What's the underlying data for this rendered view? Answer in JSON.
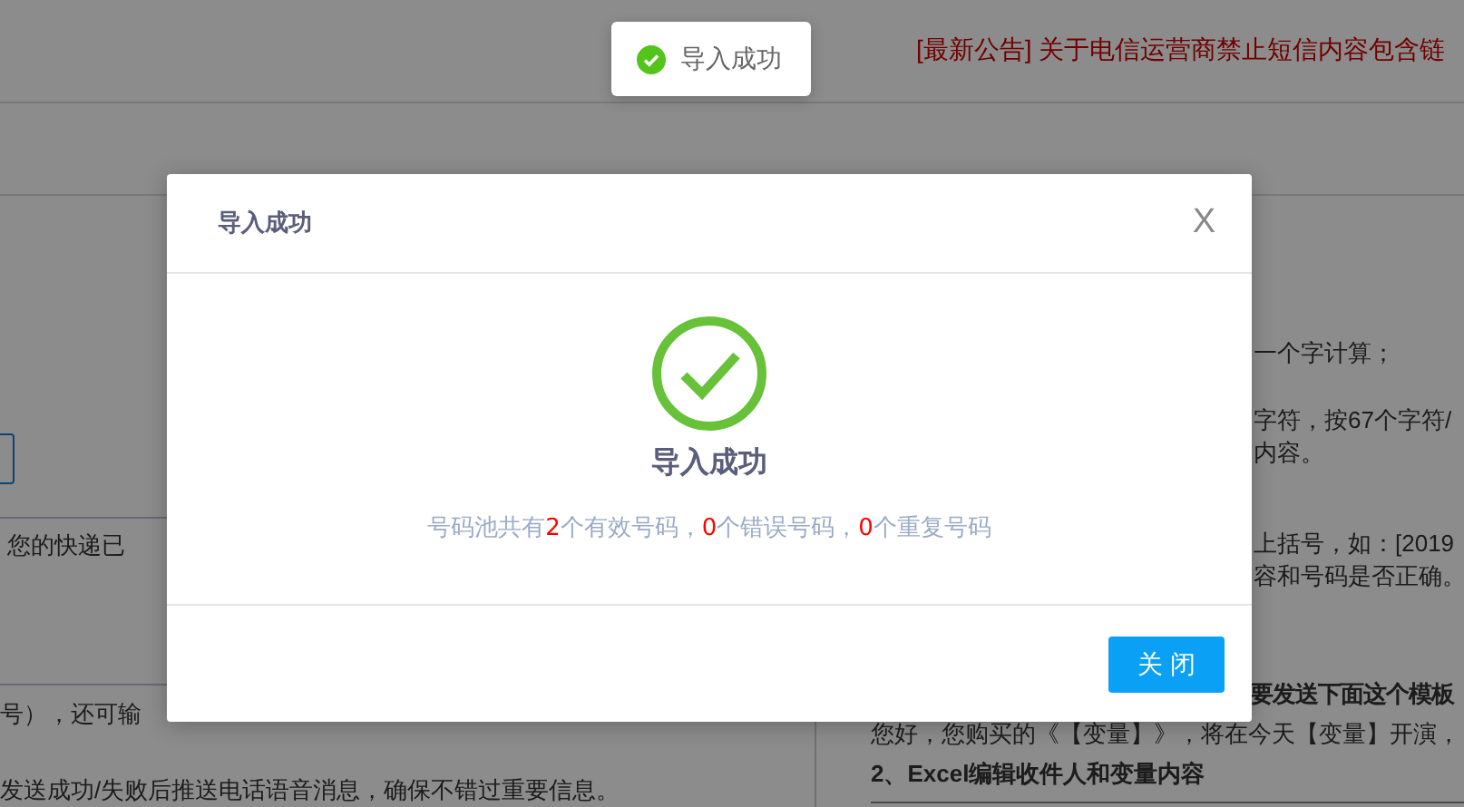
{
  "notice": "[最新公告] 关于电信运营商禁止短信内容包含链",
  "background": {
    "left_lines": [
      {
        "kind": "field",
        "text": "您的快递已"
      },
      {
        "kind": "text",
        "text": "号），还可输"
      },
      {
        "kind": "text",
        "text": "发送成功/失败后推送电话语音消息，确保不错过重要信息。"
      }
    ],
    "right_lines": [
      {
        "kind": "hidden",
        "text": "一个字计算；"
      },
      {
        "kind": "hidden",
        "text": "字符，按67个字符/"
      },
      {
        "kind": "hidden",
        "text": "内容。"
      },
      {
        "kind": "hidden",
        "text": "上括号，如：[2019"
      },
      {
        "kind": "hidden",
        "text": "容和号码是否正确。"
      },
      {
        "kind": "hidden_heading",
        "text": "要发送下面这个模板"
      },
      {
        "kind": "text",
        "text": "您好，您购买的《【变量】》，将在今天【变量】开演，"
      },
      {
        "kind": "heading",
        "text": "2、Excel编辑收件人和变量内容"
      }
    ]
  },
  "toast": {
    "text": "导入成功"
  },
  "dialog": {
    "title": "导入成功",
    "close": "X",
    "heading": "导入成功",
    "message": [
      {
        "text": "号码池共有",
        "highlight": false
      },
      {
        "text": "2",
        "highlight": true
      },
      {
        "text": "个有效号码，",
        "highlight": false
      },
      {
        "text": "0",
        "highlight": true
      },
      {
        "text": "个错误号码，",
        "highlight": false
      },
      {
        "text": "0",
        "highlight": true
      },
      {
        "text": "个重复号码",
        "highlight": false
      }
    ],
    "button": "关 闭"
  }
}
